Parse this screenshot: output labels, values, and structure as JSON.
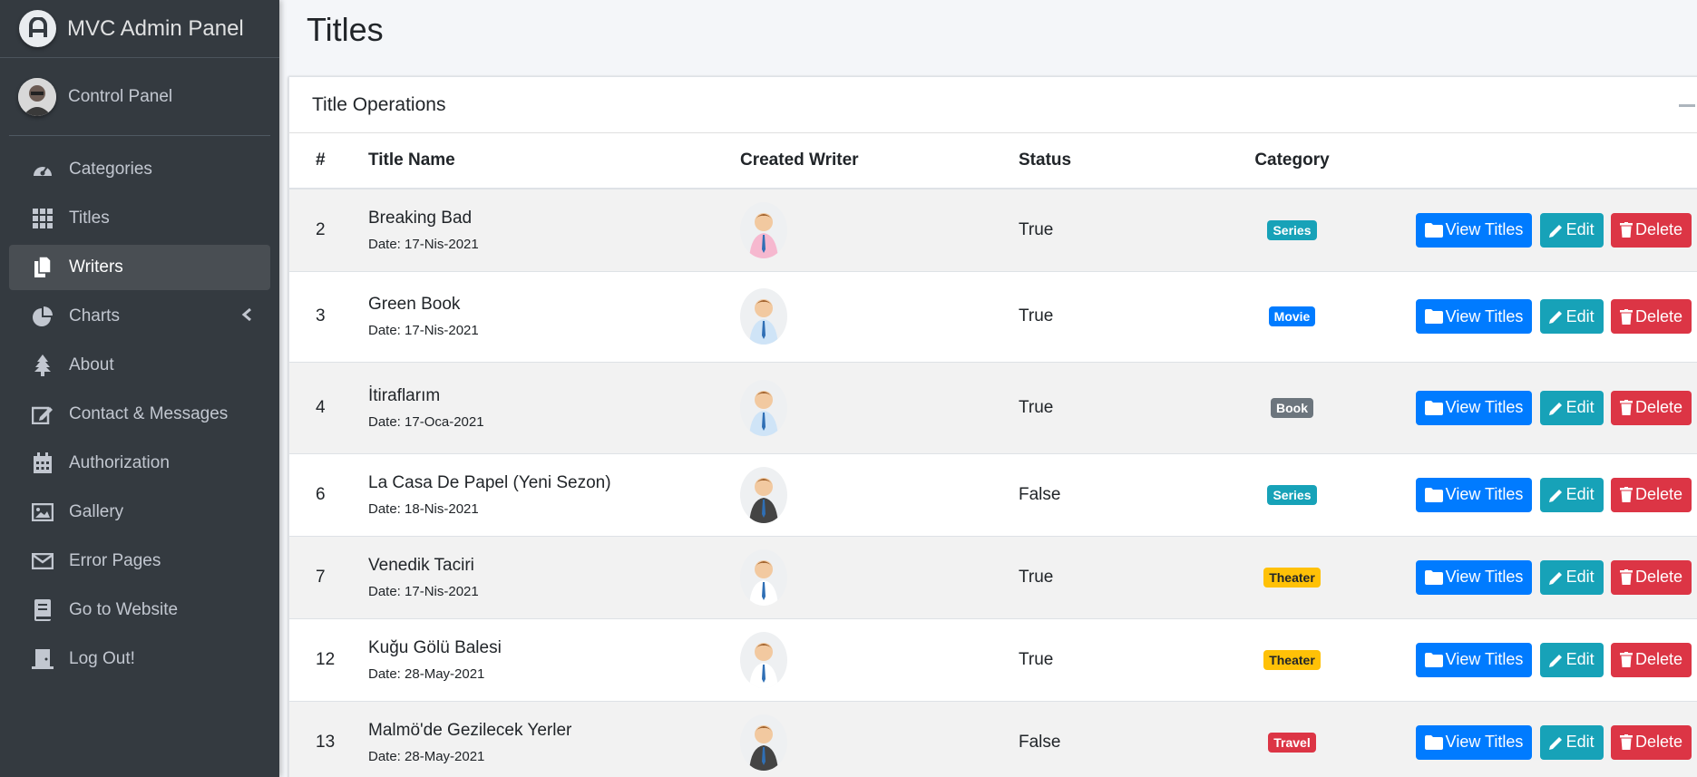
{
  "brand": {
    "name": "MVC Admin Panel"
  },
  "user": {
    "name": "Control Panel"
  },
  "sidebar": {
    "items": [
      {
        "label": "Categories",
        "icon": "tachometer-icon"
      },
      {
        "label": "Titles",
        "icon": "grid-icon"
      },
      {
        "label": "Writers",
        "icon": "copy-icon",
        "active": true
      },
      {
        "label": "Charts",
        "icon": "pie-chart-icon",
        "has_arrow": true
      },
      {
        "label": "About",
        "icon": "tree-icon"
      },
      {
        "label": "Contact & Messages",
        "icon": "edit-icon"
      },
      {
        "label": "Authorization",
        "icon": "calendar-icon"
      },
      {
        "label": "Gallery",
        "icon": "image-icon"
      },
      {
        "label": "Error Pages",
        "icon": "envelope-icon"
      },
      {
        "label": "Go to Website",
        "icon": "book-icon"
      },
      {
        "label": "Log Out!",
        "icon": "door-icon"
      }
    ]
  },
  "page": {
    "title": "Titles"
  },
  "card": {
    "header": "Title Operations",
    "columns": [
      "#",
      "Title Name",
      "Created Writer",
      "Status",
      "Category"
    ],
    "buttons": {
      "view": "View Titles",
      "edit": "Edit",
      "delete": "Delete"
    },
    "rows": [
      {
        "id": "2",
        "name": "Breaking Bad",
        "date": "Date: 17-Nis-2021",
        "status": "True",
        "category": "Series",
        "category_color": "#17a2b8",
        "writer_avatar": "woman-cartoon-avatar"
      },
      {
        "id": "3",
        "name": "Green Book",
        "date": "Date: 17-Nis-2021",
        "status": "True",
        "category": "Movie",
        "category_color": "#007bff",
        "writer_avatar": "man-cartoon-avatar"
      },
      {
        "id": "4",
        "name": "İtiraflarım",
        "date": "Date: 17-Oca-2021",
        "status": "True",
        "category": "Book",
        "category_color": "#6c757d",
        "writer_avatar": "man-cartoon-avatar"
      },
      {
        "id": "6",
        "name": "La Casa De Papel (Yeni Sezon)",
        "date": "Date: 18-Nis-2021",
        "status": "False",
        "category": "Series",
        "category_color": "#17a2b8",
        "writer_avatar": "suit-cartoon-avatar"
      },
      {
        "id": "7",
        "name": "Venedik Taciri",
        "date": "Date: 17-Nis-2021",
        "status": "True",
        "category": "Theater",
        "category_color": "#ffc107",
        "writer_avatar": "cheer-cartoon-avatar"
      },
      {
        "id": "12",
        "name": "Kuğu Gölü Balesi",
        "date": "Date: 28-May-2021",
        "status": "True",
        "category": "Theater",
        "category_color": "#ffc107",
        "writer_avatar": "cheer-cartoon-avatar"
      },
      {
        "id": "13",
        "name": "Malmö'de Gezilecek Yerler",
        "date": "Date: 28-May-2021",
        "status": "False",
        "category": "Travel",
        "category_color": "#dc3545",
        "writer_avatar": "suit-cartoon-avatar"
      }
    ]
  }
}
